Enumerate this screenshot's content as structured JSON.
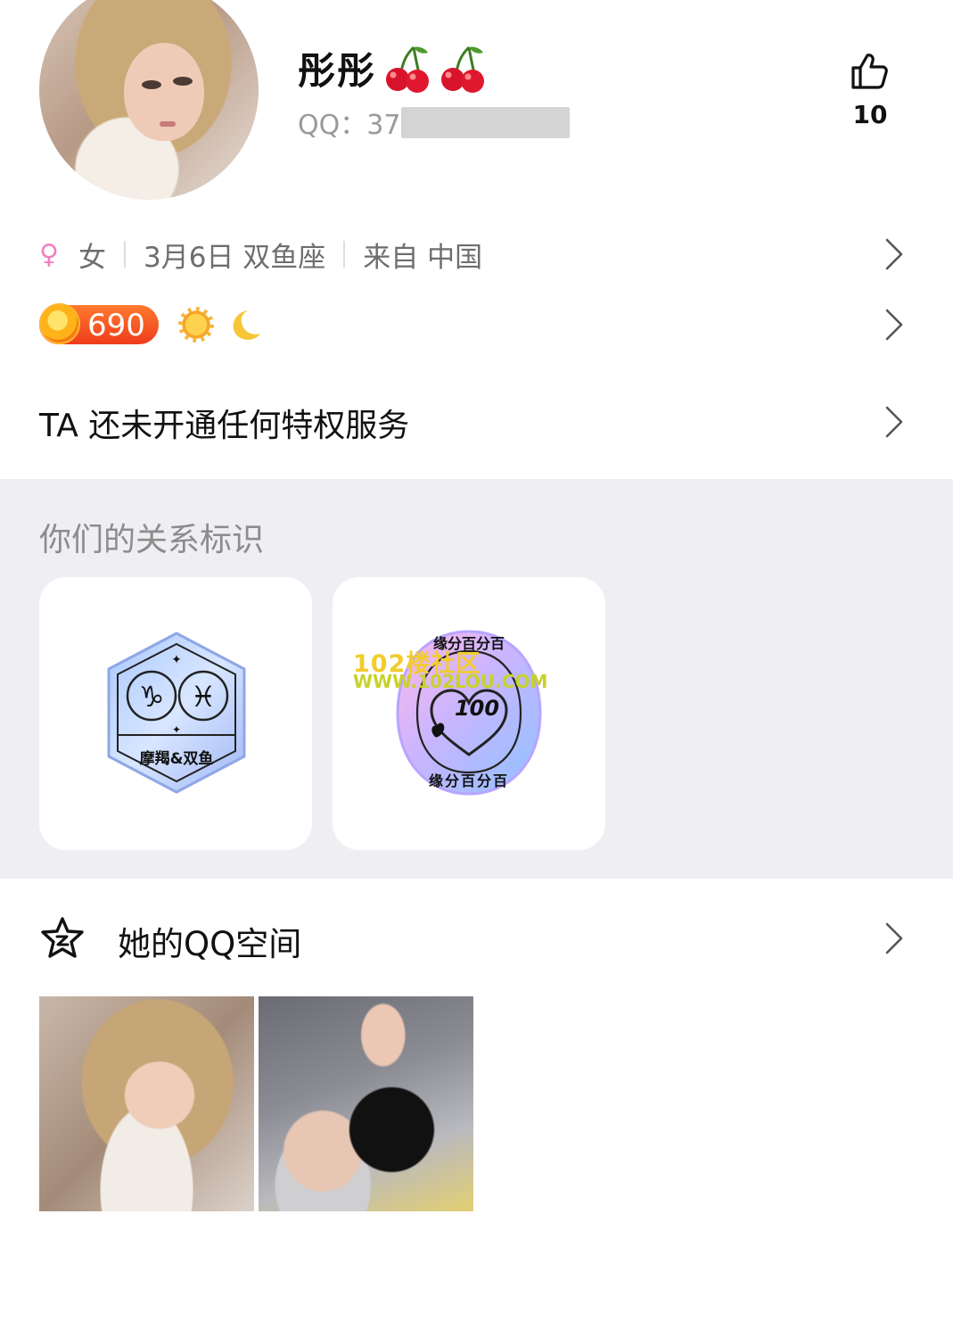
{
  "profile": {
    "name": "彤彤",
    "qq_label": "QQ：37",
    "like_count": "10"
  },
  "info": {
    "gender": "女",
    "birthday": "3月6日 双鱼座",
    "location": "来自 中国"
  },
  "level": {
    "value": "690"
  },
  "privilege": "TA 还未开通任何特权服务",
  "relation": {
    "title": "你们的关系标识",
    "badges": [
      {
        "label": "摩羯&双鱼"
      },
      {
        "number": "100",
        "ring_text_top": "缘分百分百",
        "ring_text_bottom": "缘分百分百"
      }
    ]
  },
  "watermark": {
    "line1": "102楼社区",
    "line2": "WWW.102LOU.COM"
  },
  "qzone": {
    "title": "她的QQ空间"
  },
  "colors": {
    "female": "#f17fc3",
    "level_badge": "#ef3c1c",
    "section_bg": "#efeff3"
  },
  "icons": [
    "like-icon",
    "female-icon",
    "chevron-right-icon",
    "coin-icon",
    "sun-icon",
    "moon-icon",
    "qzone-star-icon",
    "cherry-icon"
  ]
}
